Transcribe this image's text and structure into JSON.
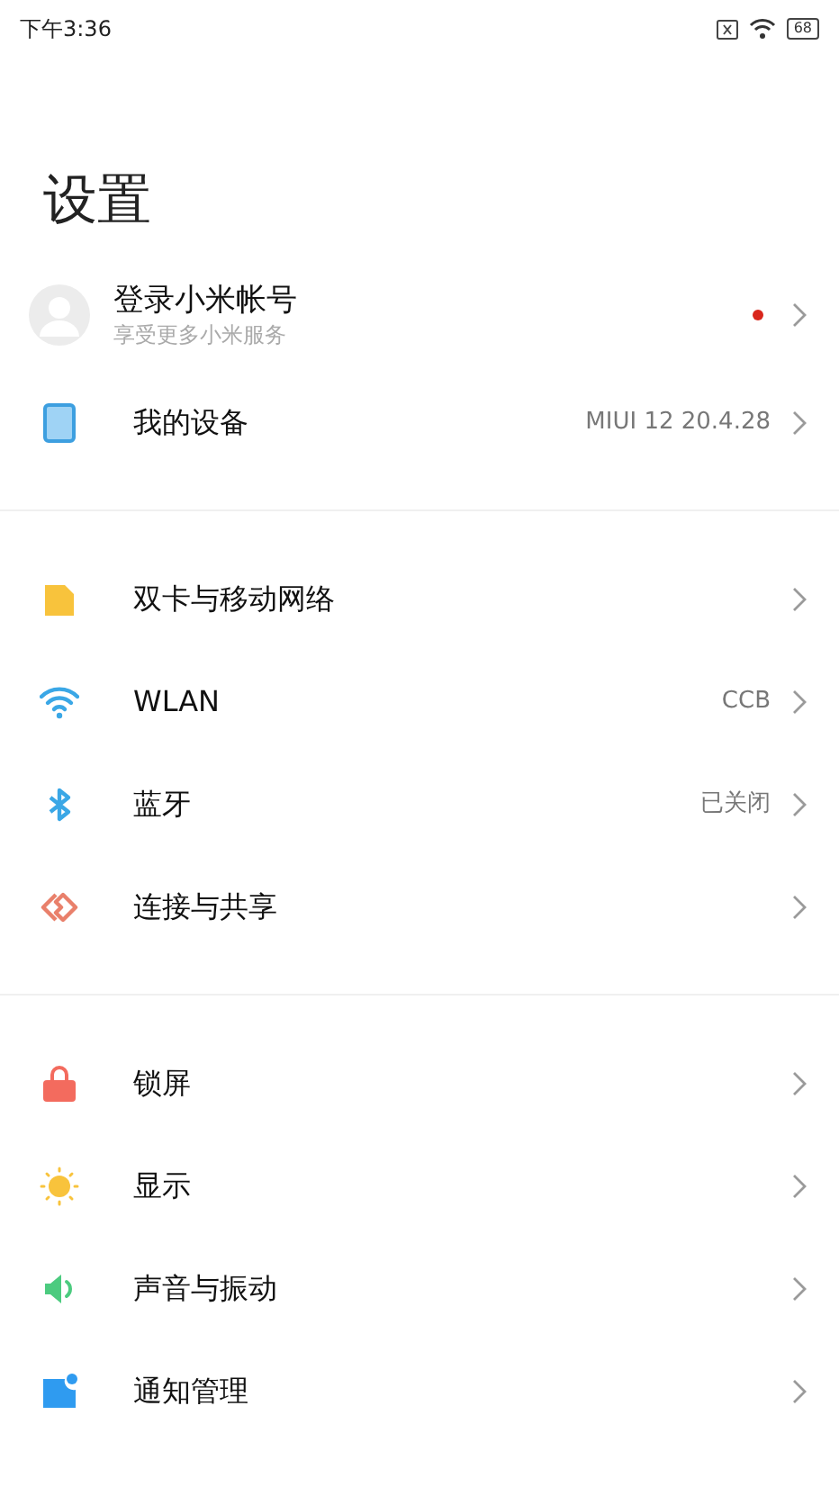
{
  "status_bar": {
    "time": "下午3:36",
    "battery": "68"
  },
  "title": "设置",
  "account": {
    "name": "登录小米帐号",
    "subtitle": "享受更多小米服务",
    "has_dot": true
  },
  "sections": [
    {
      "items": [
        {
          "kind": "device",
          "label": "我的设备",
          "value": "MIUI 12 20.4.28"
        }
      ]
    },
    {
      "items": [
        {
          "kind": "sim",
          "label": "双卡与移动网络"
        },
        {
          "kind": "wifi",
          "label": "WLAN",
          "value": "CCB"
        },
        {
          "kind": "bluetooth",
          "label": "蓝牙",
          "value": "已关闭"
        },
        {
          "kind": "share",
          "label": "连接与共享"
        }
      ]
    },
    {
      "items": [
        {
          "kind": "lock",
          "label": "锁屏"
        },
        {
          "kind": "sun",
          "label": "显示"
        },
        {
          "kind": "sound",
          "label": "声音与振动"
        },
        {
          "kind": "notification",
          "label": "通知管理"
        }
      ]
    }
  ]
}
